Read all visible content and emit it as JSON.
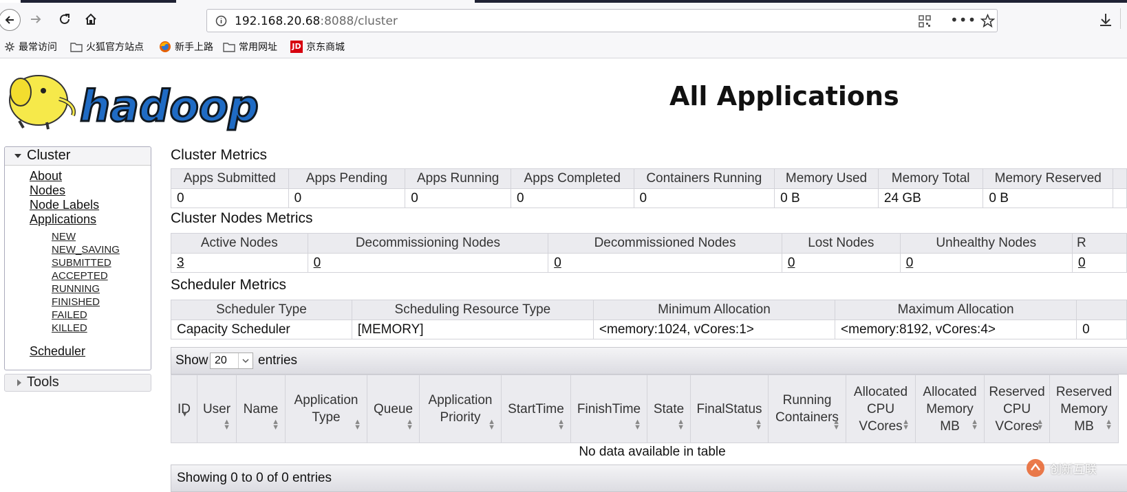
{
  "browser": {
    "url_host": "192.168.20.68",
    "url_rest": ":8088/cluster",
    "bookmarks": [
      {
        "label": "最常访问",
        "icon": "gear-icon"
      },
      {
        "label": "火狐官方站点",
        "icon": "folder-icon"
      },
      {
        "label": "新手上路",
        "icon": "firefox-icon"
      },
      {
        "label": "常用网址",
        "icon": "folder-icon"
      },
      {
        "label": "京东商城",
        "icon": "jd-icon"
      }
    ]
  },
  "page": {
    "title": "All Applications",
    "logo_text": "hadoop"
  },
  "sidebar": {
    "cluster_label": "Cluster",
    "links": [
      "About",
      "Nodes",
      "Node Labels",
      "Applications"
    ],
    "states": [
      "NEW",
      "NEW_SAVING",
      "SUBMITTED",
      "ACCEPTED",
      "RUNNING",
      "FINISHED",
      "FAILED",
      "KILLED"
    ],
    "scheduler_link": "Scheduler",
    "tools_label": "Tools"
  },
  "cluster_metrics": {
    "title": "Cluster Metrics",
    "headers": [
      "Apps Submitted",
      "Apps Pending",
      "Apps Running",
      "Apps Completed",
      "Containers Running",
      "Memory Used",
      "Memory Total",
      "Memory Reserved"
    ],
    "values": [
      "0",
      "0",
      "0",
      "0",
      "0",
      "0 B",
      "24 GB",
      "0 B"
    ]
  },
  "node_metrics": {
    "title": "Cluster Nodes Metrics",
    "headers": [
      "Active Nodes",
      "Decommissioning Nodes",
      "Decommissioned Nodes",
      "Lost Nodes",
      "Unhealthy Nodes",
      "R"
    ],
    "values": [
      "3",
      "0",
      "0",
      "0",
      "0",
      "0"
    ]
  },
  "scheduler_metrics": {
    "title": "Scheduler Metrics",
    "headers": [
      "Scheduler Type",
      "Scheduling Resource Type",
      "Minimum Allocation",
      "Maximum Allocation"
    ],
    "values": [
      "Capacity Scheduler",
      "[MEMORY]",
      "<memory:1024, vCores:1>",
      "<memory:8192, vCores:4>",
      "0"
    ]
  },
  "applications": {
    "show_label": "Show",
    "entries_label": "entries",
    "page_size": "20",
    "columns": [
      "ID",
      "User",
      "Name",
      "Application Type",
      "Queue",
      "Application Priority",
      "StartTime",
      "FinishTime",
      "State",
      "FinalStatus",
      "Running Containers",
      "Allocated CPU VCores",
      "Allocated Memory MB",
      "Reserved CPU VCores",
      "Reserved Memory MB"
    ],
    "empty_message": "No data available in table",
    "footer": "Showing 0 to 0 of 0 entries"
  },
  "watermark": "创新互联"
}
